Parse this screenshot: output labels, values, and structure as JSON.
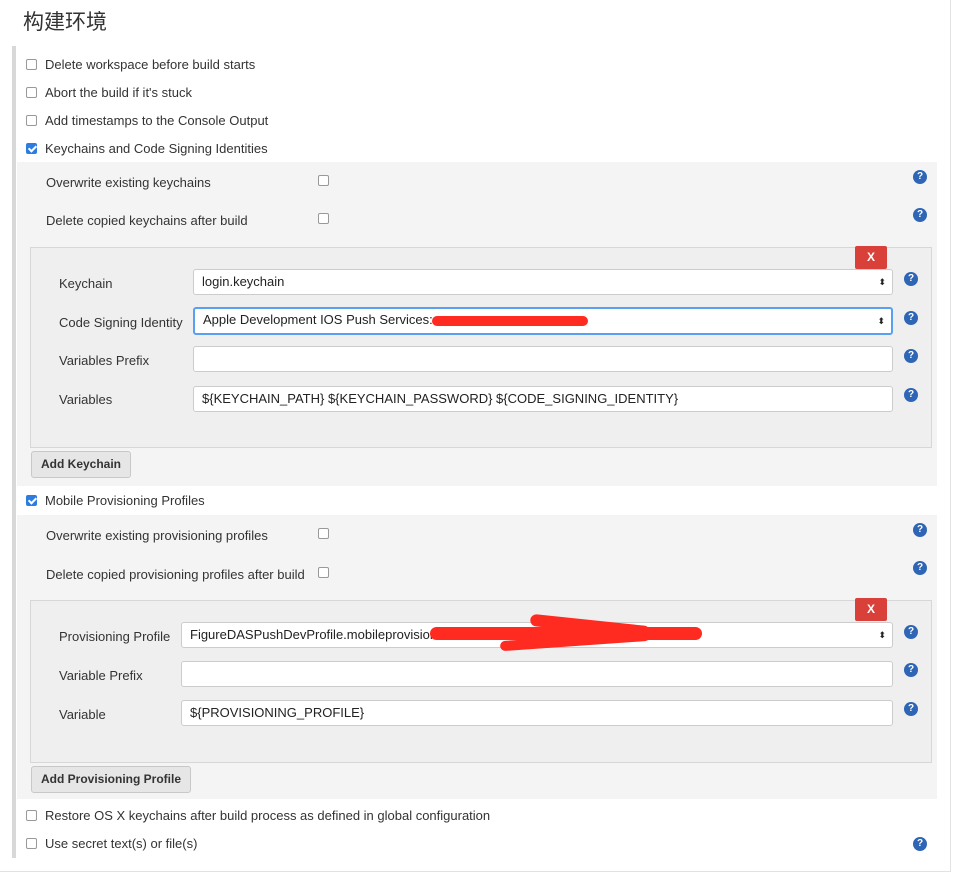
{
  "section_title": "构建环境",
  "options": {
    "delete_workspace": "Delete workspace before build starts",
    "abort_stuck": "Abort the build if it's stuck",
    "add_timestamps": "Add timestamps to the Console Output",
    "keychains_identities": "Keychains and Code Signing Identities",
    "mobile_profiles": "Mobile Provisioning Profiles",
    "restore_keychains": "Restore OS X keychains after build process as defined in global configuration",
    "secret_text": "Use secret text(s) or file(s)"
  },
  "keychains": {
    "overwrite_label": "Overwrite existing keychains",
    "delete_copied_label": "Delete copied keychains after build",
    "remove_label": "X",
    "keychain_label": "Keychain",
    "keychain_value": "login.keychain",
    "identity_label": "Code Signing Identity",
    "identity_value": "Apple Development IOS Push Services:",
    "prefix_label": "Variables Prefix",
    "prefix_value": "",
    "variables_label": "Variables",
    "variables_value": "${KEYCHAIN_PATH} ${KEYCHAIN_PASSWORD} ${CODE_SIGNING_IDENTITY}",
    "add_button": "Add Keychain"
  },
  "profiles": {
    "overwrite_label": "Overwrite existing provisioning profiles",
    "delete_copied_label": "Delete copied provisioning profiles after build",
    "remove_label": "X",
    "profile_label": "Provisioning Profile",
    "profile_value": "FigureDASPushDevProfile.mobileprovision",
    "prefix_label": "Variable Prefix",
    "prefix_value": "",
    "variable_label": "Variable",
    "variable_value": "${PROVISIONING_PROFILE}",
    "add_button": "Add Provisioning Profile"
  },
  "help_glyph": "?",
  "select_arrow_glyph": "⬍",
  "colors": {
    "checked": "#2f7ce0",
    "help": "#2e65b5",
    "remove": "#d9403a",
    "redaction": "#ff2a20",
    "focus": "#5aa0f2"
  }
}
